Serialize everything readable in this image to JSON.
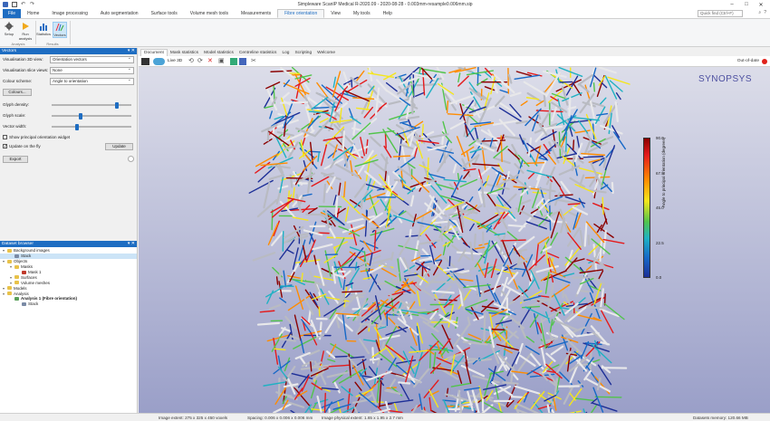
{
  "window": {
    "title": "Simpleware ScanIP Medical R-2020.09 - 2020-08-28 - 0.003mm-resample0.006mm.sip",
    "buttons": [
      "–",
      "□",
      "✕"
    ]
  },
  "ribbon_tabs": [
    "File",
    "Home",
    "Image processing",
    "Auto segmentation",
    "Surface tools",
    "Volume mesh tools",
    "Measurements",
    "Fibre orientation",
    "View",
    "My tools",
    "Help"
  ],
  "active_tab": "Fibre orientation",
  "quick_find": {
    "placeholder": "Quick find (Ctrl+F)"
  },
  "ribbon": {
    "analysis": {
      "label": "Analysis",
      "setup": "Setup",
      "run": "Run analysis"
    },
    "results": {
      "label": "Results",
      "statistics": "Statistics",
      "vectors": "Vectors"
    }
  },
  "vectors_panel": {
    "title": "Vectors",
    "vis3d_label": "Visualisation 3D view:",
    "vis3d_value": "Orientation vectors",
    "visslice_label": "Visualisation slice views:",
    "visslice_value": "None",
    "colour_scheme_label": "Colour scheme:",
    "colour_scheme_value": "Angle to orientation",
    "colours_button": "Colours...",
    "glyph_density_label": "Glyph density:",
    "glyph_density": 0.82,
    "glyph_scale_label": "Glyph scale:",
    "glyph_scale": 0.35,
    "vector_width_label": "Vector width:",
    "vector_width": 0.3,
    "show_widget_label": "Show principal orientation widget",
    "show_widget_checked": false,
    "update_fly_label": "Update on the fly",
    "update_fly_checked": true,
    "update_button": "Update",
    "export_button": "Export"
  },
  "dataset_browser": {
    "title": "Dataset browser",
    "nodes": [
      {
        "label": "Background images",
        "level": 0,
        "icon": "folder"
      },
      {
        "label": "Stack",
        "level": 1,
        "icon": "image",
        "selected": true
      },
      {
        "label": "Objects",
        "level": 0,
        "icon": "folder"
      },
      {
        "label": "Masks",
        "level": 1,
        "icon": "folder"
      },
      {
        "label": "Mask 1",
        "level": 2,
        "icon": "mask"
      },
      {
        "label": "Surfaces",
        "level": 1,
        "icon": "folder"
      },
      {
        "label": "Volume meshes",
        "level": 1,
        "icon": "folder"
      },
      {
        "label": "Models",
        "level": 0,
        "icon": "folder"
      },
      {
        "label": "Analysis",
        "level": 0,
        "icon": "folder"
      },
      {
        "label": "Analysis 1 (Fibre orientation)",
        "level": 1,
        "icon": "analysis",
        "bold": true
      },
      {
        "label": "Stack",
        "level": 2,
        "icon": "image"
      }
    ]
  },
  "document_tabs": [
    "Document",
    "Mask statistics",
    "Model statistics",
    "Centreline statistics",
    "Log",
    "Scripting",
    "Welcome"
  ],
  "active_document_tab": "Document",
  "view_toolbar": {
    "live3d": "Live 3D",
    "out_of_date": "Out-of-date"
  },
  "logo_text": "SYNOPSYS",
  "colour_bar": {
    "title": "Angle to principal orientation (degrees)",
    "ticks": [
      "90.0",
      "67.5",
      "45.0",
      "22.5",
      "0.0"
    ],
    "max": 90,
    "min": 0
  },
  "status_bar": {
    "image_extent": "Image extent: 275 x 325 x 450 voxels",
    "spacing": "Spacing: 0.006 x 0.006 x 0.006 mm",
    "physical_extent": "Image physical extent: 1.65 x 1.95 x 2.7 mm",
    "memory": "Datasets memory: 120.66 MB"
  },
  "colors": {
    "accent": "#1e6dc2",
    "viewport_top": "#dcdde9",
    "viewport_bottom": "#9a9fc8"
  }
}
